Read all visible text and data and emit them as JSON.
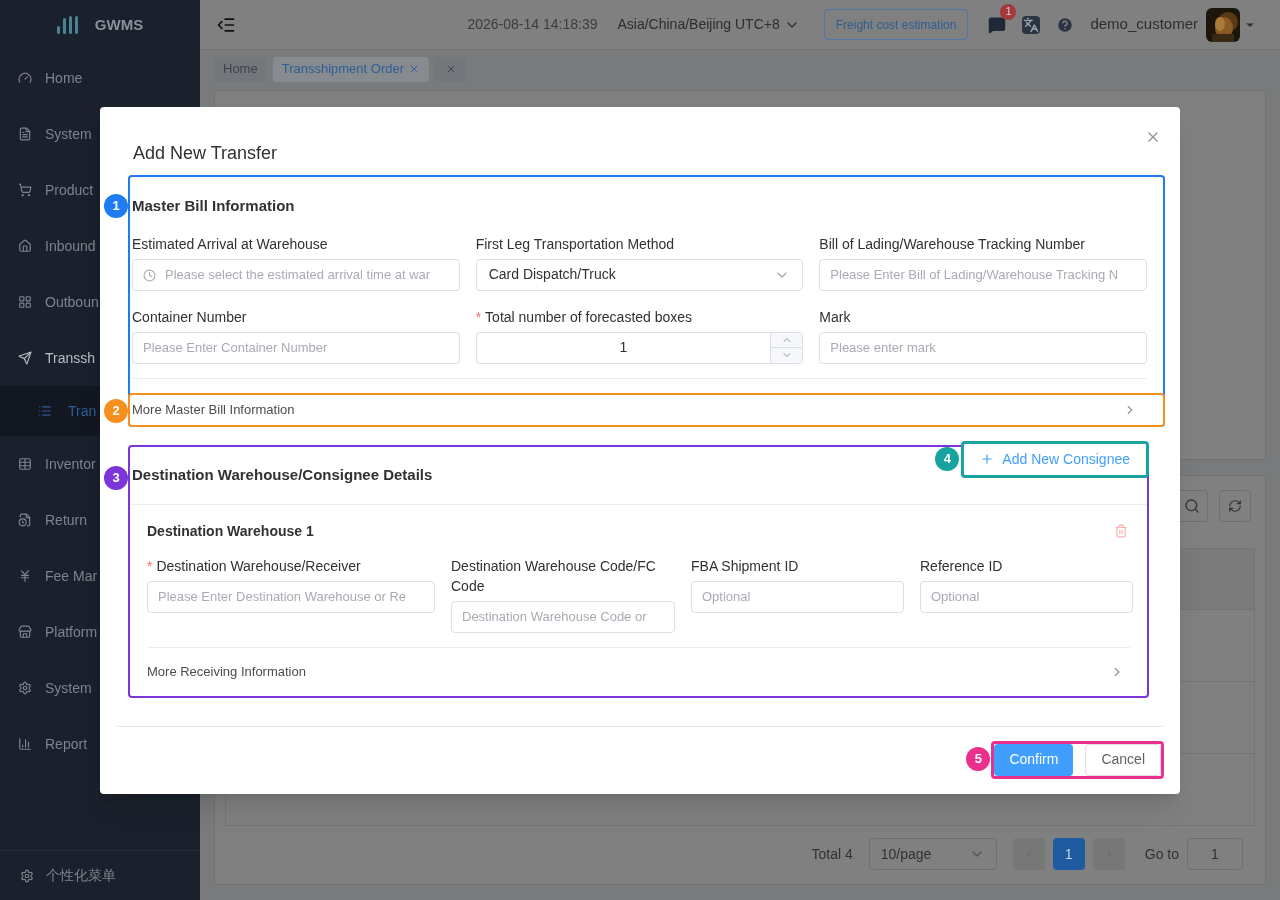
{
  "sidebar": {
    "logo": "GWMS",
    "items": [
      {
        "label": "Home",
        "selected": false,
        "expanded": false
      },
      {
        "label": "System",
        "selected": false,
        "expanded": false
      },
      {
        "label": "Product",
        "selected": false,
        "expanded": false
      },
      {
        "label": "Inbound",
        "selected": false,
        "expanded": false
      },
      {
        "label": "Outboun",
        "selected": false,
        "expanded": false
      },
      {
        "label": "Transsh",
        "selected": false,
        "expanded": true,
        "children": [
          {
            "label": "Tran",
            "selected": true
          }
        ]
      },
      {
        "label": "Inventor",
        "selected": false,
        "expanded": false
      },
      {
        "label": "Return",
        "selected": false,
        "expanded": false
      },
      {
        "label": "Fee Mar",
        "selected": false,
        "expanded": false
      },
      {
        "label": "Platform",
        "selected": false,
        "expanded": false
      },
      {
        "label": "System",
        "selected": false,
        "expanded": false
      },
      {
        "label": "Report",
        "selected": false,
        "expanded": false
      }
    ],
    "footer": "个性化菜单"
  },
  "header": {
    "datetime": "2026-08-14 14:18:39",
    "timezone": "Asia/China/Beijing UTC+8",
    "freight_button": "Freight cost estimation",
    "notification_count": "1",
    "user": "demo_customer"
  },
  "tabs": [
    {
      "label": "Home",
      "selected": false,
      "closable": false
    },
    {
      "label": "Transshipment Order",
      "selected": true,
      "closable": true
    }
  ],
  "pagination": {
    "total": "Total 4",
    "page_size": "10/page",
    "pages": [
      {
        "label": "1",
        "selected": true
      }
    ],
    "goto_label": "Go to",
    "goto_value": "1"
  },
  "annotations": [
    {
      "number": "1",
      "color": "#1e7bf2"
    },
    {
      "number": "2",
      "color": "#f5901e"
    },
    {
      "number": "3",
      "color": "#7b35d9"
    },
    {
      "number": "4",
      "color": "#19a3a0"
    },
    {
      "number": "5",
      "color": "#e8308c"
    }
  ],
  "dialog": {
    "title": "Add New Transfer",
    "required_mark": "*",
    "master": {
      "title": "Master Bill Information",
      "fields": [
        {
          "label": "Estimated Arrival at Warehouse",
          "required": false,
          "kind": "date",
          "placeholder": "Please select the estimated arrival time at war"
        },
        {
          "label": "First Leg Transportation Method",
          "required": false,
          "kind": "select",
          "value": "Card Dispatch/Truck"
        },
        {
          "label": "Bill of Lading/Warehouse Tracking Number",
          "required": false,
          "kind": "text",
          "placeholder": "Please Enter Bill of Lading/Warehouse Tracking N"
        },
        {
          "label": "Container Number",
          "required": false,
          "kind": "text",
          "placeholder": "Please Enter Container Number"
        },
        {
          "label": "Total number of forecasted boxes",
          "required": true,
          "kind": "number",
          "value": "1"
        },
        {
          "label": "Mark",
          "required": false,
          "kind": "text",
          "placeholder": "Please enter mark"
        }
      ],
      "more": "More Master Bill Information"
    },
    "destination": {
      "title": "Destination Warehouse/Consignee Details",
      "add_button": "Add New Consignee",
      "warehouses": [
        {
          "title": "Destination Warehouse 1",
          "fields": [
            {
              "label": "Destination Warehouse/Receiver",
              "required": true,
              "kind": "text",
              "placeholder": "Please Enter Destination Warehouse or Re"
            },
            {
              "label": "Destination Warehouse Code/FC Code",
              "required": false,
              "kind": "text",
              "placeholder": "Destination Warehouse Code or"
            },
            {
              "label": "FBA Shipment ID",
              "required": false,
              "kind": "text",
              "placeholder": "Optional"
            },
            {
              "label": "Reference ID",
              "required": false,
              "kind": "text",
              "placeholder": "Optional"
            }
          ],
          "more": "More Receiving Information"
        }
      ]
    },
    "confirm": "Confirm",
    "cancel": "Cancel"
  }
}
